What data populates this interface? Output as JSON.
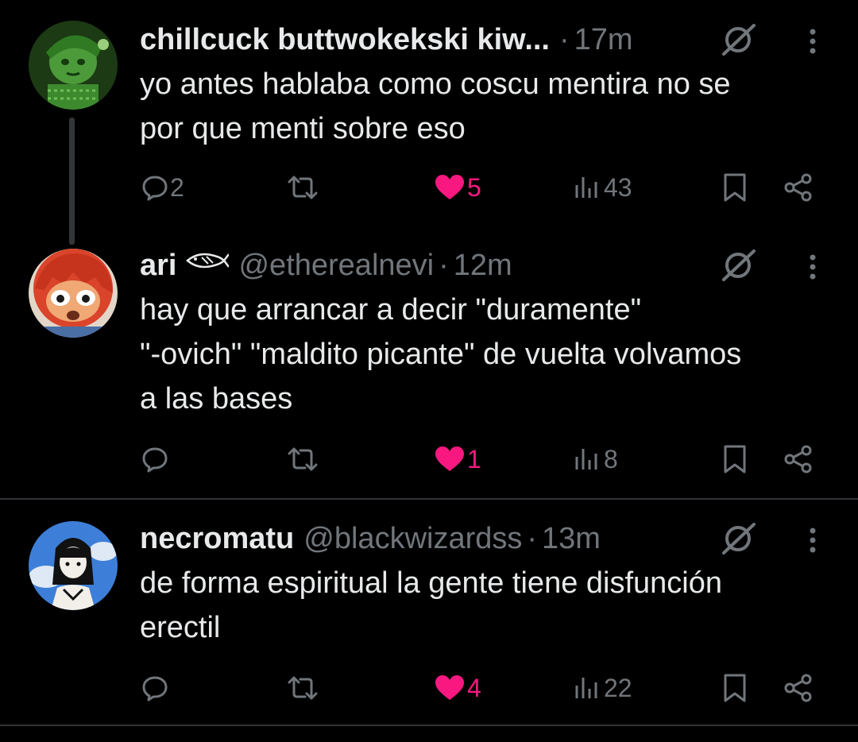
{
  "colors": {
    "background": "#000000",
    "text": "#e7e9ea",
    "muted": "#71767b",
    "like": "#f91880",
    "divider": "#2f3336"
  },
  "tweets": [
    {
      "name": "chillcuck buttwokekski kiw...",
      "handle": "",
      "separator": "·",
      "time": "17m",
      "text_lines": [
        "yo antes hablaba como coscu mentira no se",
        "por que menti sobre eso"
      ],
      "replies": "2",
      "reposts": "",
      "likes": "5",
      "liked": true,
      "views": "43"
    },
    {
      "name": "ari",
      "handle": "@etherealnevi",
      "separator": "·",
      "time": "12m",
      "text_lines": [
        "hay que arrancar a decir \"duramente\"",
        "\"-ovich\" \"maldito picante\" de vuelta volvamos",
        "a las bases"
      ],
      "replies": "",
      "reposts": "",
      "likes": "1",
      "liked": true,
      "views": "8"
    },
    {
      "name": "necromatu",
      "handle": "@blackwizardss",
      "separator": "·",
      "time": "13m",
      "text_lines": [
        "de forma espiritual la gente tiene disfunción",
        "erectil"
      ],
      "replies": "",
      "reposts": "",
      "likes": "4",
      "liked": true,
      "views": "22"
    }
  ],
  "icons": [
    "reply-icon",
    "repost-icon",
    "heart-icon",
    "views-icon",
    "bookmark-icon",
    "share-icon",
    "grok-icon",
    "more-icon",
    "fish-emoji-icon"
  ]
}
